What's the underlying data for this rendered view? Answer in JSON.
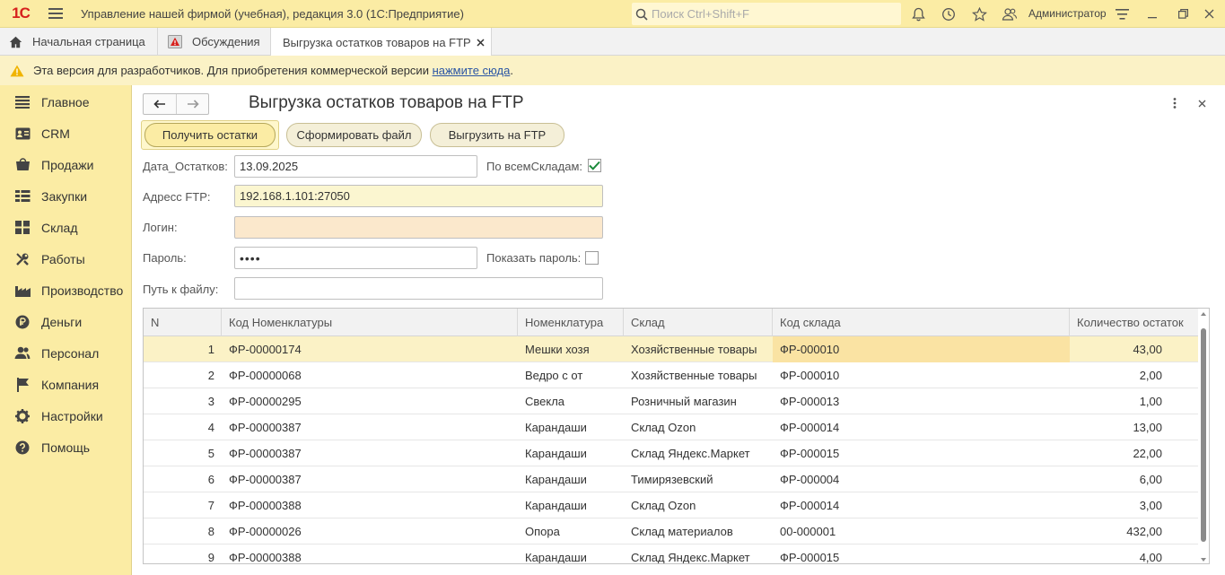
{
  "app": {
    "logo": "1С",
    "title": "Управление нашей фирмой (учебная), редакция 3.0  (1С:Предприятие)",
    "search_placeholder": "Поиск Ctrl+Shift+F",
    "user": "Администратор"
  },
  "tabs": [
    {
      "label": "Начальная страница",
      "icon": "home-icon"
    },
    {
      "label": "Обсуждения",
      "icon": "discussions-icon"
    },
    {
      "label": "Выгрузка остатков товаров на FTP",
      "icon": "close-icon"
    }
  ],
  "banner": {
    "text": "Эта версия для разработчиков. Для приобретения коммерческой версии ",
    "link": "нажмите сюда",
    "suffix": "."
  },
  "sidebar": {
    "items": [
      {
        "label": "Главное",
        "icon": "list-icon"
      },
      {
        "label": "CRM",
        "icon": "crm-icon"
      },
      {
        "label": "Продажи",
        "icon": "sales-icon"
      },
      {
        "label": "Закупки",
        "icon": "purchases-icon"
      },
      {
        "label": "Склад",
        "icon": "warehouse-icon"
      },
      {
        "label": "Работы",
        "icon": "tools-icon"
      },
      {
        "label": "Производство",
        "icon": "factory-icon"
      },
      {
        "label": "Деньги",
        "icon": "money-icon"
      },
      {
        "label": "Персонал",
        "icon": "people-icon"
      },
      {
        "label": "Компания",
        "icon": "flag-icon"
      },
      {
        "label": "Настройки",
        "icon": "gear-icon"
      },
      {
        "label": "Помощь",
        "icon": "help-icon"
      }
    ]
  },
  "form": {
    "title": "Выгрузка остатков товаров на FTP",
    "buttons": {
      "get_stock": "Получить остатки",
      "make_file": "Сформировать файл",
      "upload_ftp": "Выгрузить на FTP"
    },
    "fields": {
      "date_label": "Дата_Остатков:",
      "date_value": "13.09.2025",
      "all_wh_label": "По всемСкладам:",
      "all_wh_checked": true,
      "ftp_label": "Адресс FTP:",
      "ftp_value": "192.168.1.101:27050",
      "login_label": "Логин:",
      "login_value": "",
      "password_label": "Пароль:",
      "password_value": "••••",
      "show_password_label": "Показать пароль:",
      "show_password_checked": false,
      "path_label": "Путь к файлу:",
      "path_value": ""
    }
  },
  "table": {
    "columns": [
      "N",
      "Код Номенклатуры",
      "Номенклатура",
      "Склад",
      "Код склада",
      "Количество остаток"
    ],
    "rows": [
      [
        "1",
        "ФР-00000174",
        "Мешки хозя",
        "Хозяйственные товары",
        "ФР-000010",
        "43,00"
      ],
      [
        "2",
        "ФР-00000068",
        "Ведро с от",
        "Хозяйственные товары",
        "ФР-000010",
        "2,00"
      ],
      [
        "3",
        "ФР-00000295",
        "Свекла",
        "Розничный магазин",
        "ФР-000013",
        "1,00"
      ],
      [
        "4",
        "ФР-00000387",
        "Карандаши",
        "Склад Ozon",
        "ФР-000014",
        "13,00"
      ],
      [
        "5",
        "ФР-00000387",
        "Карандаши",
        "Склад Яндекс.Маркет",
        "ФР-000015",
        "22,00"
      ],
      [
        "6",
        "ФР-00000387",
        "Карандаши",
        "Тимирязевский",
        "ФР-000004",
        "6,00"
      ],
      [
        "7",
        "ФР-00000388",
        "Карандаши",
        "Склад Ozon",
        "ФР-000014",
        "3,00"
      ],
      [
        "8",
        "ФР-00000026",
        "Опора",
        "Склад материалов",
        "00-000001",
        "432,00"
      ],
      [
        "9",
        "ФР-00000388",
        "Карандаши",
        "Склад Яндекс.Маркет",
        "ФР-000015",
        "4,00"
      ]
    ]
  }
}
